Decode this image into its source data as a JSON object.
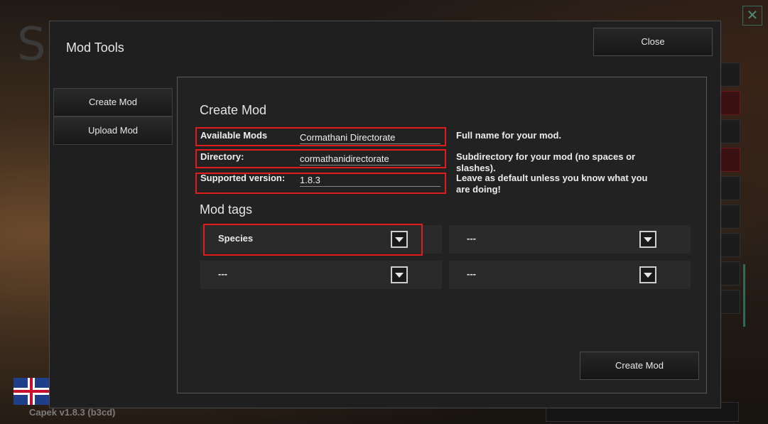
{
  "background": {
    "logo_letter": "S",
    "corner_close_symbol": "✕",
    "version_text": "Capek v1.8.3 (b3cd)",
    "flag_icon": "uk-flag-icon"
  },
  "dialog": {
    "title": "Mod Tools",
    "close_label": "Close",
    "sidebar": {
      "create_mod_label": "Create Mod",
      "upload_mod_label": "Upload Mod"
    },
    "panel": {
      "section_title": "Create Mod",
      "fields": {
        "name": {
          "label": "Available Mods",
          "value": "Cormathani Directorate",
          "hint": "Full name for your mod."
        },
        "directory": {
          "label": "Directory:",
          "value": "cormathanidirectorate",
          "hint": "Subdirectory for your mod (no spaces or slashes)."
        },
        "version": {
          "label": "Supported version:",
          "value": "1.8.3",
          "hint": "Leave as default unless you know what you are doing!"
        }
      },
      "tags_title": "Mod tags",
      "tags": [
        "Species",
        "---",
        "---",
        "---"
      ],
      "create_button_label": "Create Mod"
    }
  },
  "colors": {
    "highlight_red": "#e21b1b",
    "accent_teal": "#2f6b5b"
  }
}
